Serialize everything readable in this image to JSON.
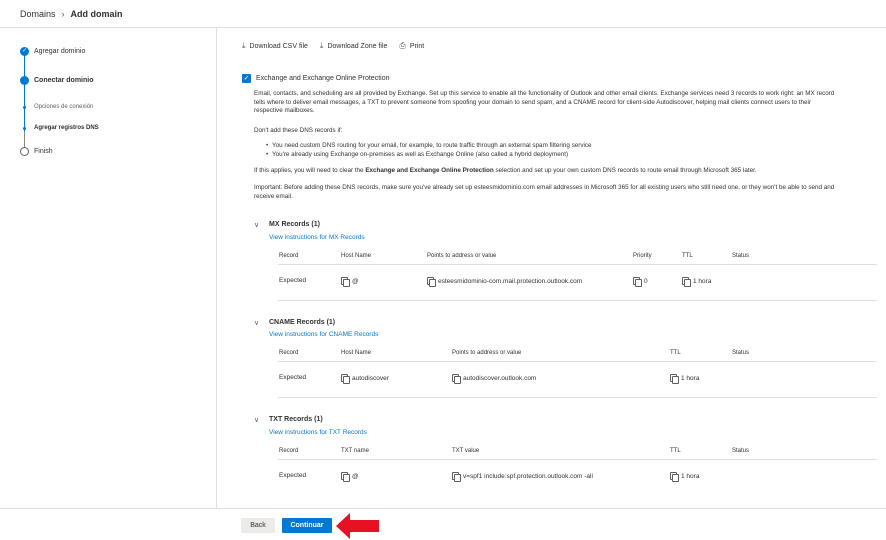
{
  "breadcrumb": {
    "root": "Domains",
    "current": "Add domain"
  },
  "steps": [
    {
      "label": "Agregar dominio"
    },
    {
      "label": "Conectar dominio"
    },
    {
      "label": "Opciones de conexión"
    },
    {
      "label": "Agregar registros DNS"
    },
    {
      "label": "Finish"
    }
  ],
  "toolbar": {
    "download_csv": "Download CSV file",
    "download_zone": "Download Zone file",
    "print": "Print"
  },
  "exchange": {
    "label": "Exchange and Exchange Online Protection",
    "desc1": "Email, contacts, and scheduling are all provided by Exchange. Set up this service to enable all the functionality of Outlook and other email clients. Exchange services need 3 records to work right: an MX record",
    "desc2": "tells where to deliver email messages, a TXT to prevent someone from spoofing your domain to send spam, and a CNAME record for client-side Autodiscover, helping mail clients connect users to their",
    "desc3": "respective mailboxes.",
    "dont_add": "Don't add these DNS records if:",
    "bullet1": "You need custom DNS routing for your email, for example, to route traffic through an external spam filtering service",
    "bullet2": "You're already using Exchange on-premises as well as Exchange Online (also called a hybrid deployment)",
    "applies_pre": "If this applies, you will need to clear the ",
    "applies_bold": "Exchange and Exchange Online Protection",
    "applies_post": " selection and set up your own custom DNS records to route email through Microsoft 365 later.",
    "important1": "Important: Before adding these DNS records, make sure you've already set up esteesmidominio.com email addresses in Microsoft 365 for all existing users who still need one, or they won't be able to send and",
    "important2": "receive email."
  },
  "mx": {
    "title": "MX Records (1)",
    "link": "View instructions for MX Records",
    "headers": {
      "record": "Record",
      "host": "Host Name",
      "points": "Points to address or value",
      "priority": "Priority",
      "ttl": "TTL",
      "status": "Status"
    },
    "row": {
      "record": "Expected",
      "host": "@",
      "points": "esteesmidominio-com.mail.protection.outlook.com",
      "priority": "0",
      "ttl": "1 hora"
    }
  },
  "cname": {
    "title": "CNAME Records (1)",
    "link": "View instructions for CNAME Records",
    "headers": {
      "record": "Record",
      "host": "Host Name",
      "points": "Points to address or value",
      "ttl": "TTL",
      "status": "Status"
    },
    "row": {
      "record": "Expected",
      "host": "autodiscover",
      "points": "autodiscover.outlook.com",
      "ttl": "1 hora"
    }
  },
  "txt": {
    "title": "TXT Records (1)",
    "link": "View instructions for TXT Records",
    "headers": {
      "record": "Record",
      "name": "TXT name",
      "value": "TXT value",
      "ttl": "TTL",
      "status": "Status"
    },
    "row": {
      "record": "Expected",
      "name": "@",
      "value": "v=spf1 include:spf.protection.outlook.com -all",
      "ttl": "1 hora"
    }
  },
  "footer": {
    "back": "Back",
    "continue": "Continuar"
  },
  "colors": {
    "accent": "#0078d4",
    "arrow": "#e81123"
  }
}
